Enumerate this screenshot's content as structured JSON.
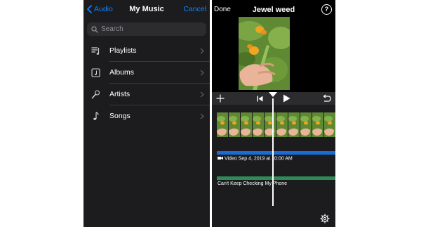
{
  "music_panel": {
    "back_label": "Audio",
    "title": "My Music",
    "cancel_label": "Cancel",
    "search": {
      "placeholder": "Search",
      "value": ""
    },
    "items": [
      {
        "label": "Playlists",
        "icon": "playlist-icon"
      },
      {
        "label": "Albums",
        "icon": "album-icon"
      },
      {
        "label": "Artists",
        "icon": "microphone-icon"
      },
      {
        "label": "Songs",
        "icon": "music-note-icon"
      }
    ]
  },
  "editor": {
    "done_label": "Done",
    "project_title": "Jewel weed",
    "help_label": "?",
    "video_track_label": "Video Sep 4, 2019 at 10:00 AM",
    "audio_track_label": "Can't Keep Checking My Phone"
  },
  "colors": {
    "accent": "#0a84ff",
    "video_track": "#1a6bd8",
    "audio_track": "#2e8b57",
    "panel_bg": "#1c1c1e",
    "editor_bg": "#000000"
  }
}
